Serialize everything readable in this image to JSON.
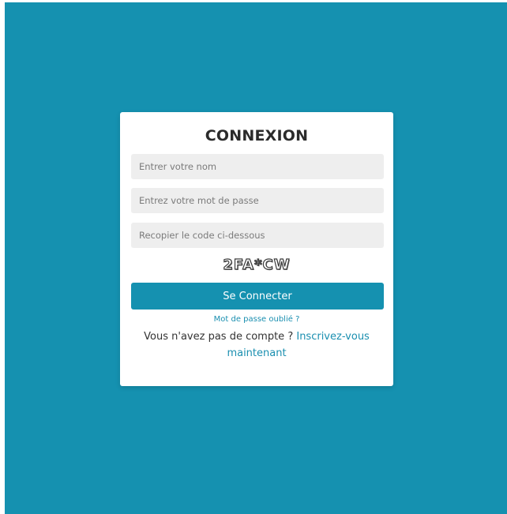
{
  "login": {
    "title": "CONNEXION",
    "username_placeholder": "Entrer votre nom",
    "password_placeholder": "Entrez votre mot de passe",
    "captcha_placeholder": "Recopier le code ci-dessous",
    "captcha_code": "2FA*CW",
    "submit_label": "Se Connecter",
    "forgot_password_link": "Mot de passe oublié ?",
    "no_account_text": "Vous n'avez pas de compte ?",
    "register_link": "Inscrivez-vous maintenant"
  },
  "colors": {
    "background": "#1591b0",
    "button": "#1591b0",
    "link": "#1a8fb0",
    "field_background": "#eeeeee"
  }
}
